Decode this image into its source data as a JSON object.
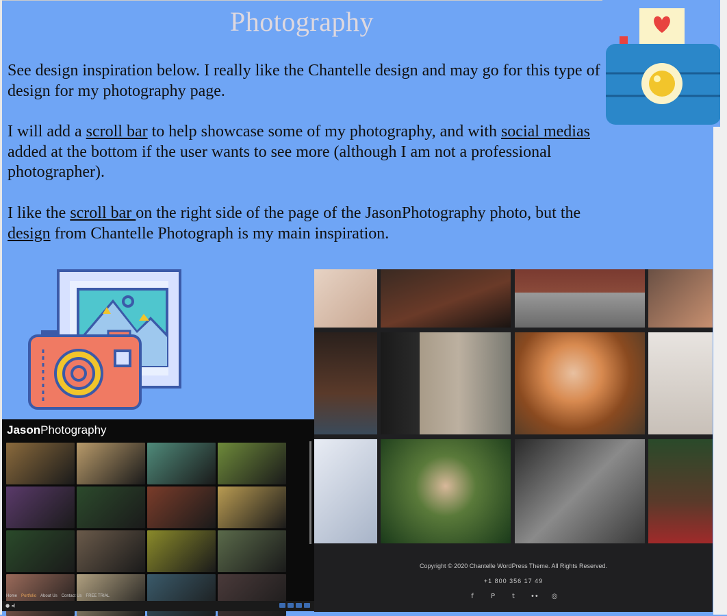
{
  "slide": {
    "title": "Photography",
    "paragraphs": {
      "p1": "See design inspiration below. I really like the Chantelle design and may go for this type of design for my photography page.",
      "p2_a": " I will add a ",
      "p2_link1": "scroll bar",
      "p2_b": " to help showcase some of  my photography, and with ",
      "p2_link2": "social medias ",
      "p2_c": " added at the bottom if the user wants to see more (although I am not a professional photographer).",
      "p3_a": "I like the ",
      "p3_link1": "scroll bar ",
      "p3_b": "on the right side of the page of the JasonPhotography photo, but the ",
      "p3_link2": "design",
      "p3_c": " from Chantelle Photograph is my main inspiration."
    }
  },
  "jason": {
    "logo_bold": "Jason",
    "logo_rest": "Photography",
    "nav": [
      "Home",
      "Portfolio",
      "About Us",
      "Contact Us",
      "FREE TRIAL"
    ],
    "active_nav": "Portfolio",
    "tile_colors": [
      "#8a6a3c",
      "#b89a6a",
      "#4f8a7a",
      "#6e8a3a",
      "#5a3a6a",
      "#2c4a2c",
      "#7a3c2a",
      "#b99b52",
      "#2a4a2a",
      "#6a5a4a",
      "#8a8a2a",
      "#5a6a4a",
      "#9a6a5a",
      "#b0a080",
      "#3a5a6a",
      "#4a3a3a"
    ]
  },
  "chantelle": {
    "copyright": "Copyright © 2020 Chantelle WordPress Theme. All Rights Reserved.",
    "phone": "+1 800 356 17 49",
    "social_icons": [
      "facebook-icon",
      "pinterest-icon",
      "twitter-icon",
      "flickr-icon",
      "instagram-icon"
    ],
    "social_glyphs": [
      "f",
      "P",
      "t",
      "••",
      "◎"
    ]
  },
  "colors": {
    "background": "#6fa5f5",
    "title": "#ded8df",
    "footer": "#1f1f21"
  }
}
